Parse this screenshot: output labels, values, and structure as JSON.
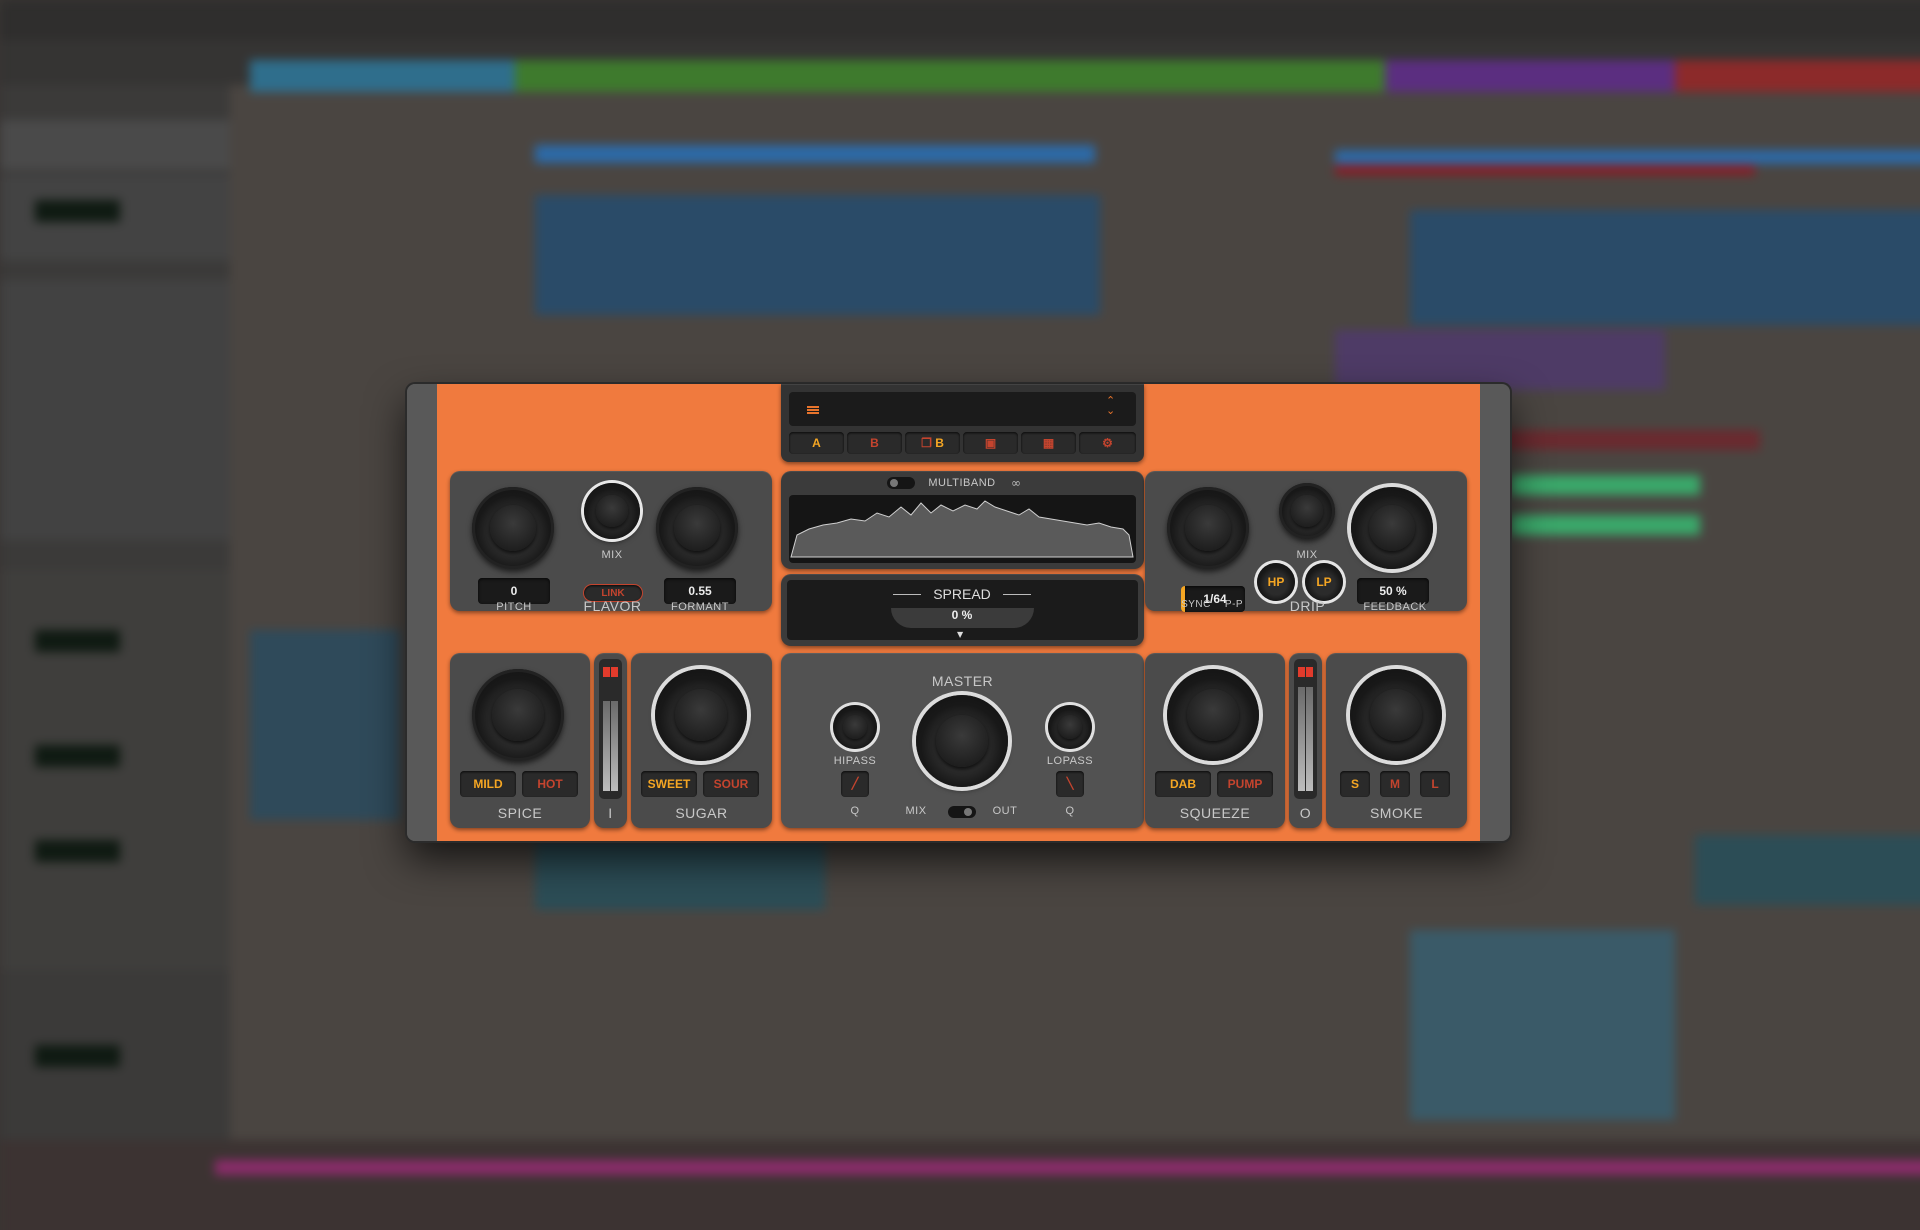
{
  "background": {
    "description": "blurred DAW arrangement view"
  },
  "plugin": {
    "preset_bar": {
      "menu_icon": "hamburger-icon",
      "nav_icon": "up-down-chevron-icon",
      "ab": [
        {
          "label": "A",
          "state": "on"
        },
        {
          "label": "B",
          "state": "off"
        },
        {
          "label": "B",
          "prefix_icon": "copy-icon",
          "state": "on"
        },
        {
          "label": "",
          "icon": "clipboard-icon",
          "state": "off"
        },
        {
          "label": "",
          "icon": "calendar-icon",
          "state": "off"
        },
        {
          "label": "",
          "icon": "gear-icon",
          "state": "off"
        }
      ]
    },
    "flavor": {
      "title": "FLAVOR",
      "pitch_value": "0",
      "pitch_label": "PITCH",
      "mix_label": "MIX",
      "link_label": "LINK",
      "formant_value": "0.55",
      "formant_label": "FORMANT"
    },
    "multiband": {
      "label": "MULTIBAND",
      "link_icon": "link-icon"
    },
    "spread": {
      "title": "SPREAD",
      "value": "0 %"
    },
    "drip": {
      "title": "DRIP",
      "mix_label": "MIX",
      "sync_value": "1/64",
      "sync_label": "SYNC",
      "pp_label": "P-P",
      "hp_label": "HP",
      "lp_label": "LP",
      "feedback_value": "50 %",
      "feedback_label": "FEEDBACK"
    },
    "spice": {
      "title": "SPICE",
      "mild": "MILD",
      "hot": "HOT"
    },
    "input_meter": {
      "label": "I"
    },
    "sugar": {
      "title": "SUGAR",
      "sweet": "SWEET",
      "sour": "SOUR"
    },
    "master": {
      "title": "MASTER",
      "hipass_label": "HIPASS",
      "lopass_label": "LOPASS",
      "q_left": "Q",
      "q_right": "Q",
      "mix_label": "MIX",
      "out_label": "OUT"
    },
    "squeeze": {
      "title": "SQUEEZE",
      "dab": "DAB",
      "pump": "PUMP"
    },
    "output_meter": {
      "label": "O"
    },
    "smoke": {
      "title": "SMOKE",
      "s": "S",
      "m": "M",
      "l": "L"
    }
  },
  "colors": {
    "accent": "#f5a623",
    "off": "#c4442e",
    "chassis": "#f07a3e"
  }
}
